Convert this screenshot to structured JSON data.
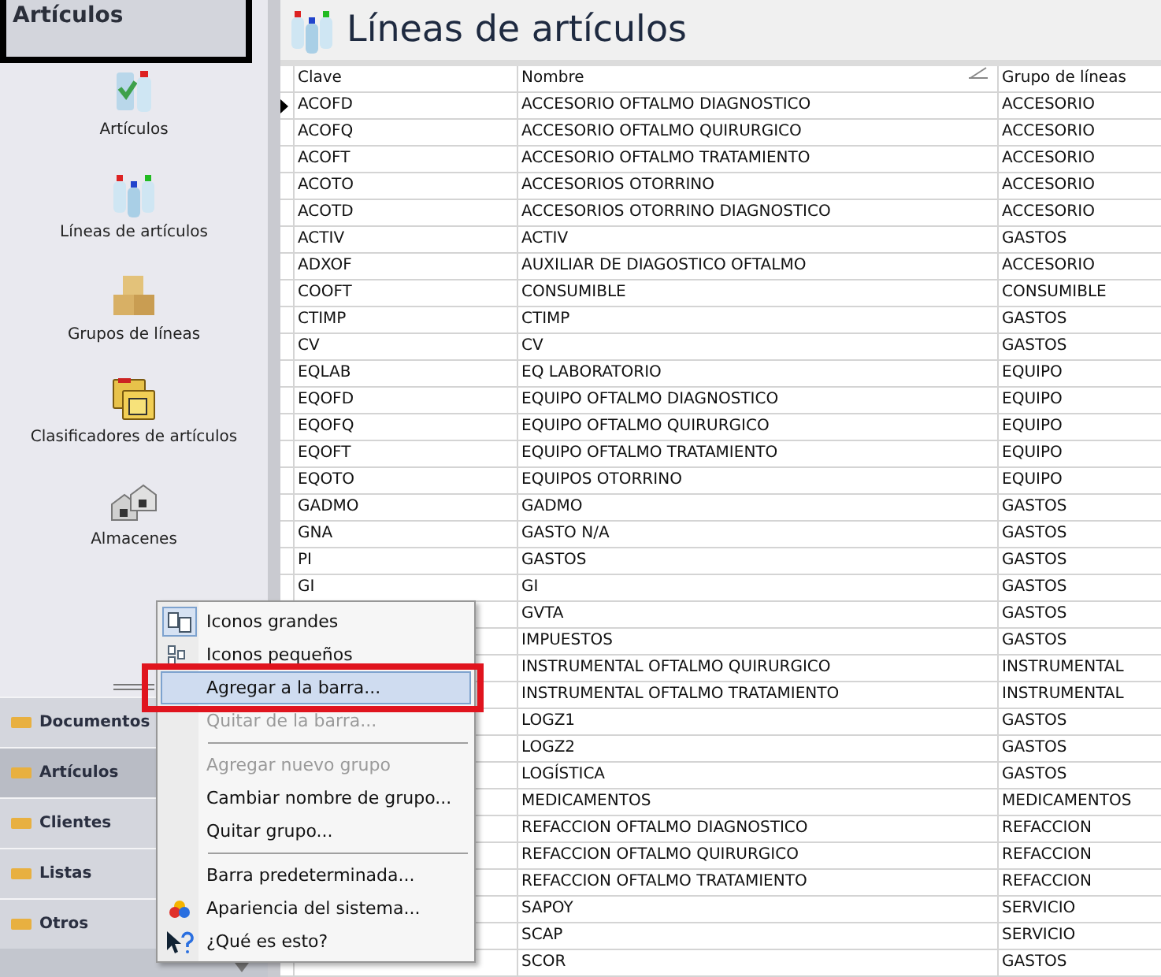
{
  "sidebar": {
    "title": "Artículos",
    "items": [
      {
        "label": "Artículos",
        "kind": "articles"
      },
      {
        "label": "Líneas de artículos",
        "kind": "bottles"
      },
      {
        "label": "Grupos de líneas",
        "kind": "boxes"
      },
      {
        "label": "Clasificadores de artículos",
        "kind": "folders"
      },
      {
        "label": "Almacenes",
        "kind": "warehouses"
      }
    ],
    "groups": [
      {
        "label": "Documentos",
        "selected": false
      },
      {
        "label": "Artículos",
        "selected": true
      },
      {
        "label": "Clientes",
        "selected": false
      },
      {
        "label": "Listas",
        "selected": false
      },
      {
        "label": "Otros",
        "selected": false
      }
    ]
  },
  "page_title": "Líneas de artículos",
  "table": {
    "columns": [
      {
        "label": "Clave",
        "sorted": false
      },
      {
        "label": "Nombre",
        "sorted": true
      },
      {
        "label": "Grupo de líneas",
        "sorted": false
      }
    ],
    "rows": [
      {
        "current": true,
        "clave": "ACOFD",
        "nombre": "ACCESORIO OFTALMO DIAGNOSTICO",
        "grupo": "ACCESORIO"
      },
      {
        "clave": "ACOFQ",
        "nombre": "ACCESORIO OFTALMO QUIRURGICO",
        "grupo": "ACCESORIO"
      },
      {
        "clave": "ACOFT",
        "nombre": "ACCESORIO OFTALMO TRATAMIENTO",
        "grupo": "ACCESORIO"
      },
      {
        "clave": "ACOTO",
        "nombre": "ACCESORIOS OTORRINO",
        "grupo": "ACCESORIO"
      },
      {
        "clave": "ACOTD",
        "nombre": "ACCESORIOS OTORRINO DIAGNOSTICO",
        "grupo": "ACCESORIO"
      },
      {
        "clave": "ACTIV",
        "nombre": "ACTIV",
        "grupo": "GASTOS"
      },
      {
        "clave": "ADXOF",
        "nombre": "AUXILIAR DE DIAGOSTICO OFTALMO",
        "grupo": "ACCESORIO"
      },
      {
        "clave": "COOFT",
        "nombre": "CONSUMIBLE",
        "grupo": "CONSUMIBLE"
      },
      {
        "clave": "CTIMP",
        "nombre": "CTIMP",
        "grupo": "GASTOS"
      },
      {
        "clave": "CV",
        "nombre": "CV",
        "grupo": "GASTOS"
      },
      {
        "clave": "EQLAB",
        "nombre": "EQ LABORATORIO",
        "grupo": "EQUIPO"
      },
      {
        "clave": "EQOFD",
        "nombre": "EQUIPO OFTALMO DIAGNOSTICO",
        "grupo": "EQUIPO"
      },
      {
        "clave": "EQOFQ",
        "nombre": "EQUIPO OFTALMO QUIRURGICO",
        "grupo": "EQUIPO"
      },
      {
        "clave": "EQOFT",
        "nombre": "EQUIPO OFTALMO TRATAMIENTO",
        "grupo": "EQUIPO"
      },
      {
        "clave": "EQOTO",
        "nombre": "EQUIPOS OTORRINO",
        "grupo": "EQUIPO"
      },
      {
        "clave": "GADMO",
        "nombre": "GADMO",
        "grupo": "GASTOS"
      },
      {
        "clave": "GNA",
        "nombre": "GASTO N/A",
        "grupo": "GASTOS"
      },
      {
        "clave": "PI",
        "nombre": "GASTOS",
        "grupo": "GASTOS"
      },
      {
        "clave": "GI",
        "nombre": "GI",
        "grupo": "GASTOS"
      },
      {
        "nombre": "GVTA",
        "grupo": "GASTOS"
      },
      {
        "nombre": "IMPUESTOS",
        "grupo": "GASTOS"
      },
      {
        "nombre": "INSTRUMENTAL OFTALMO QUIRURGICO",
        "grupo": "INSTRUMENTAL"
      },
      {
        "nombre": "INSTRUMENTAL OFTALMO TRATAMIENTO",
        "grupo": "INSTRUMENTAL"
      },
      {
        "nombre": "LOGZ1",
        "grupo": "GASTOS"
      },
      {
        "nombre": "LOGZ2",
        "grupo": "GASTOS"
      },
      {
        "nombre": "LOGÍSTICA",
        "grupo": "GASTOS"
      },
      {
        "nombre": "MEDICAMENTOS",
        "grupo": "MEDICAMENTOS"
      },
      {
        "nombre": "REFACCION OFTALMO DIAGNOSTICO",
        "grupo": "REFACCION"
      },
      {
        "nombre": "REFACCION OFTALMO QUIRURGICO",
        "grupo": "REFACCION"
      },
      {
        "nombre": "REFACCION OFTALMO TRATAMIENTO",
        "grupo": "REFACCION"
      },
      {
        "nombre": "SAPOY",
        "grupo": "SERVICIO"
      },
      {
        "nombre": "SCAP",
        "grupo": "SERVICIO"
      },
      {
        "nombre": "SCOR",
        "grupo": "GASTOS"
      }
    ]
  },
  "context_menu": [
    {
      "kind": "large_icons",
      "label": "Iconos grandes",
      "checked": true,
      "disabled": false,
      "selected": false
    },
    {
      "kind": "small_icons",
      "label": "Iconos pequeños",
      "checked": false,
      "disabled": false,
      "selected": false
    },
    {
      "kind": "item",
      "label": "Agregar a la barra...",
      "checked": false,
      "disabled": false,
      "selected": true
    },
    {
      "kind": "item",
      "label": "Quitar de la barra...",
      "checked": false,
      "disabled": true,
      "selected": false
    },
    {
      "kind": "separator"
    },
    {
      "kind": "item",
      "label": "Agregar nuevo grupo",
      "checked": false,
      "disabled": true,
      "selected": false
    },
    {
      "kind": "item",
      "label": "Cambiar nombre de grupo...",
      "checked": false,
      "disabled": false,
      "selected": false
    },
    {
      "kind": "item",
      "label": "Quitar grupo...",
      "checked": false,
      "disabled": false,
      "selected": false
    },
    {
      "kind": "separator"
    },
    {
      "kind": "item",
      "label": "Barra predeterminada...",
      "checked": false,
      "disabled": false,
      "selected": false
    },
    {
      "kind": "appearance",
      "label": "Apariencia del sistema...",
      "checked": false,
      "disabled": false,
      "selected": false
    },
    {
      "kind": "help",
      "label": "¿Qué es esto?",
      "checked": false,
      "disabled": false,
      "selected": false
    }
  ]
}
